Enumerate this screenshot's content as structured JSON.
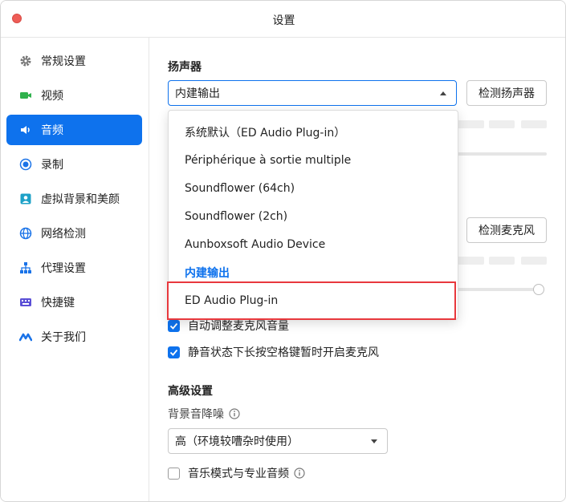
{
  "window": {
    "title": "设置"
  },
  "sidebar": {
    "items": [
      {
        "label": "常规设置",
        "icon": "gear-icon",
        "color": "#777777"
      },
      {
        "label": "视频",
        "icon": "video-camera-icon",
        "color": "#2fb14c"
      },
      {
        "label": "音频",
        "icon": "speaker-icon",
        "color": "#ffffff",
        "active": true
      },
      {
        "label": "录制",
        "icon": "record-icon",
        "color": "#1a73e8"
      },
      {
        "label": "虚拟背景和美颜",
        "icon": "portrait-icon",
        "color": "#1ea1c7"
      },
      {
        "label": "网络检测",
        "icon": "globe-icon",
        "color": "#1a73e8"
      },
      {
        "label": "代理设置",
        "icon": "network-tree-icon",
        "color": "#1a73e8"
      },
      {
        "label": "快捷键",
        "icon": "keyboard-icon",
        "color": "#5b4fd6"
      },
      {
        "label": "关于我们",
        "icon": "logo-icon",
        "color": "#1a73e8"
      }
    ]
  },
  "speaker": {
    "section_title": "扬声器",
    "selected_device": "内建输出",
    "test_button": "检测扬声器"
  },
  "microphone": {
    "test_button": "检测麦克风",
    "auto_adjust_label": "自动调整麦克风音量",
    "auto_adjust_checked": true,
    "push_to_talk_label": "静音状态下长按空格键暂时开启麦克风",
    "push_to_talk_checked": true
  },
  "advanced": {
    "section_title": "高级设置",
    "noise_label": "背景音降噪",
    "noise_value": "高（环境较嘈杂时使用）",
    "music_mode_label": "音乐模式与专业音频",
    "music_mode_checked": false
  },
  "dropdown": {
    "options": [
      "系统默认（ED Audio Plug-in）",
      "Périphérique à sortie multiple",
      "Soundflower (64ch)",
      "Soundflower (2ch)",
      "Aunboxsoft Audio Device",
      "内建输出",
      "ED Audio Plug-in"
    ],
    "current_index": 5,
    "highlighted_index": 6
  },
  "colors": {
    "accent": "#0e72ed",
    "highlight_border": "#e8383d"
  }
}
